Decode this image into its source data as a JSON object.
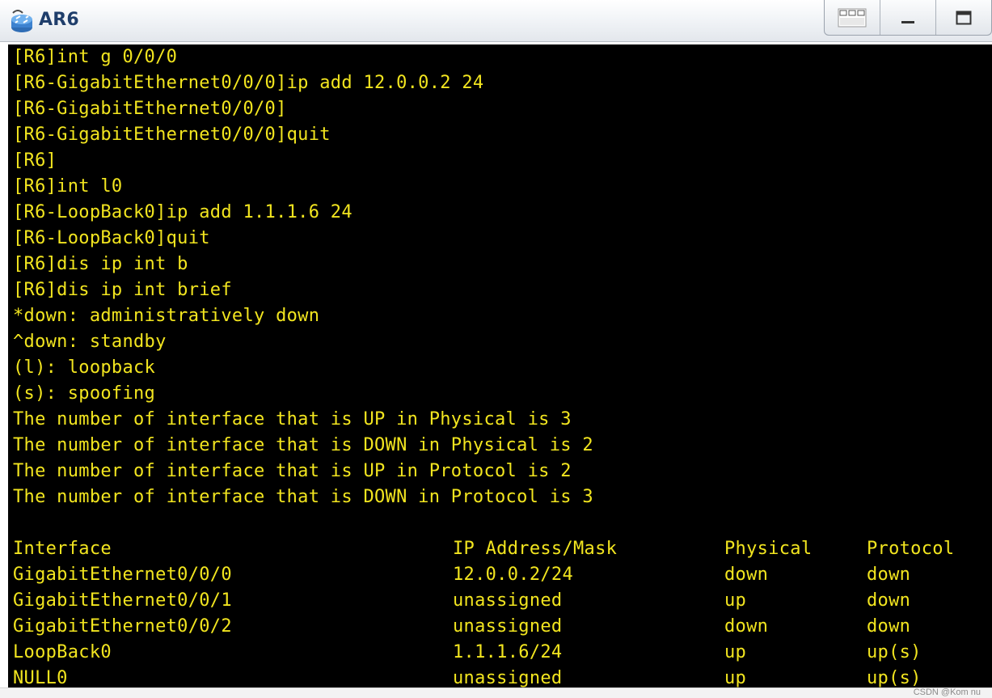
{
  "window": {
    "title": "AR6",
    "icons": [
      "router-app-icon",
      "restore-layout-icon",
      "minimize-icon",
      "maximize-icon"
    ]
  },
  "terminal": {
    "text_color": "#f2e51f",
    "background": "#000000",
    "lines": [
      "[R6]int g 0/0/0",
      "[R6-GigabitEthernet0/0/0]ip add 12.0.0.2 24",
      "[R6-GigabitEthernet0/0/0]",
      "[R6-GigabitEthernet0/0/0]quit",
      "[R6]",
      "[R6]int l0",
      "[R6-LoopBack0]ip add 1.1.1.6 24",
      "[R6-LoopBack0]quit",
      "[R6]dis ip int b",
      "[R6]dis ip int brief",
      "*down: administratively down",
      "^down: standby",
      "(l): loopback",
      "(s): spoofing",
      "The number of interface that is UP in Physical is 3",
      "The number of interface that is DOWN in Physical is 2",
      "The number of interface that is UP in Protocol is 2",
      "The number of interface that is DOWN in Protocol is 3"
    ],
    "table": {
      "headers": [
        "Interface",
        "IP Address/Mask",
        "Physical",
        "Protocol"
      ],
      "rows": [
        [
          "GigabitEthernet0/0/0",
          "12.0.0.2/24",
          "down",
          "down"
        ],
        [
          "GigabitEthernet0/0/1",
          "unassigned",
          "up",
          "down"
        ],
        [
          "GigabitEthernet0/0/2",
          "unassigned",
          "down",
          "down"
        ],
        [
          "LoopBack0",
          "1.1.1.6/24",
          "up",
          "up(s)"
        ],
        [
          "NULL0",
          "unassigned",
          "up",
          "up(s)"
        ]
      ]
    }
  },
  "watermark": "CSDN @Kom nu"
}
